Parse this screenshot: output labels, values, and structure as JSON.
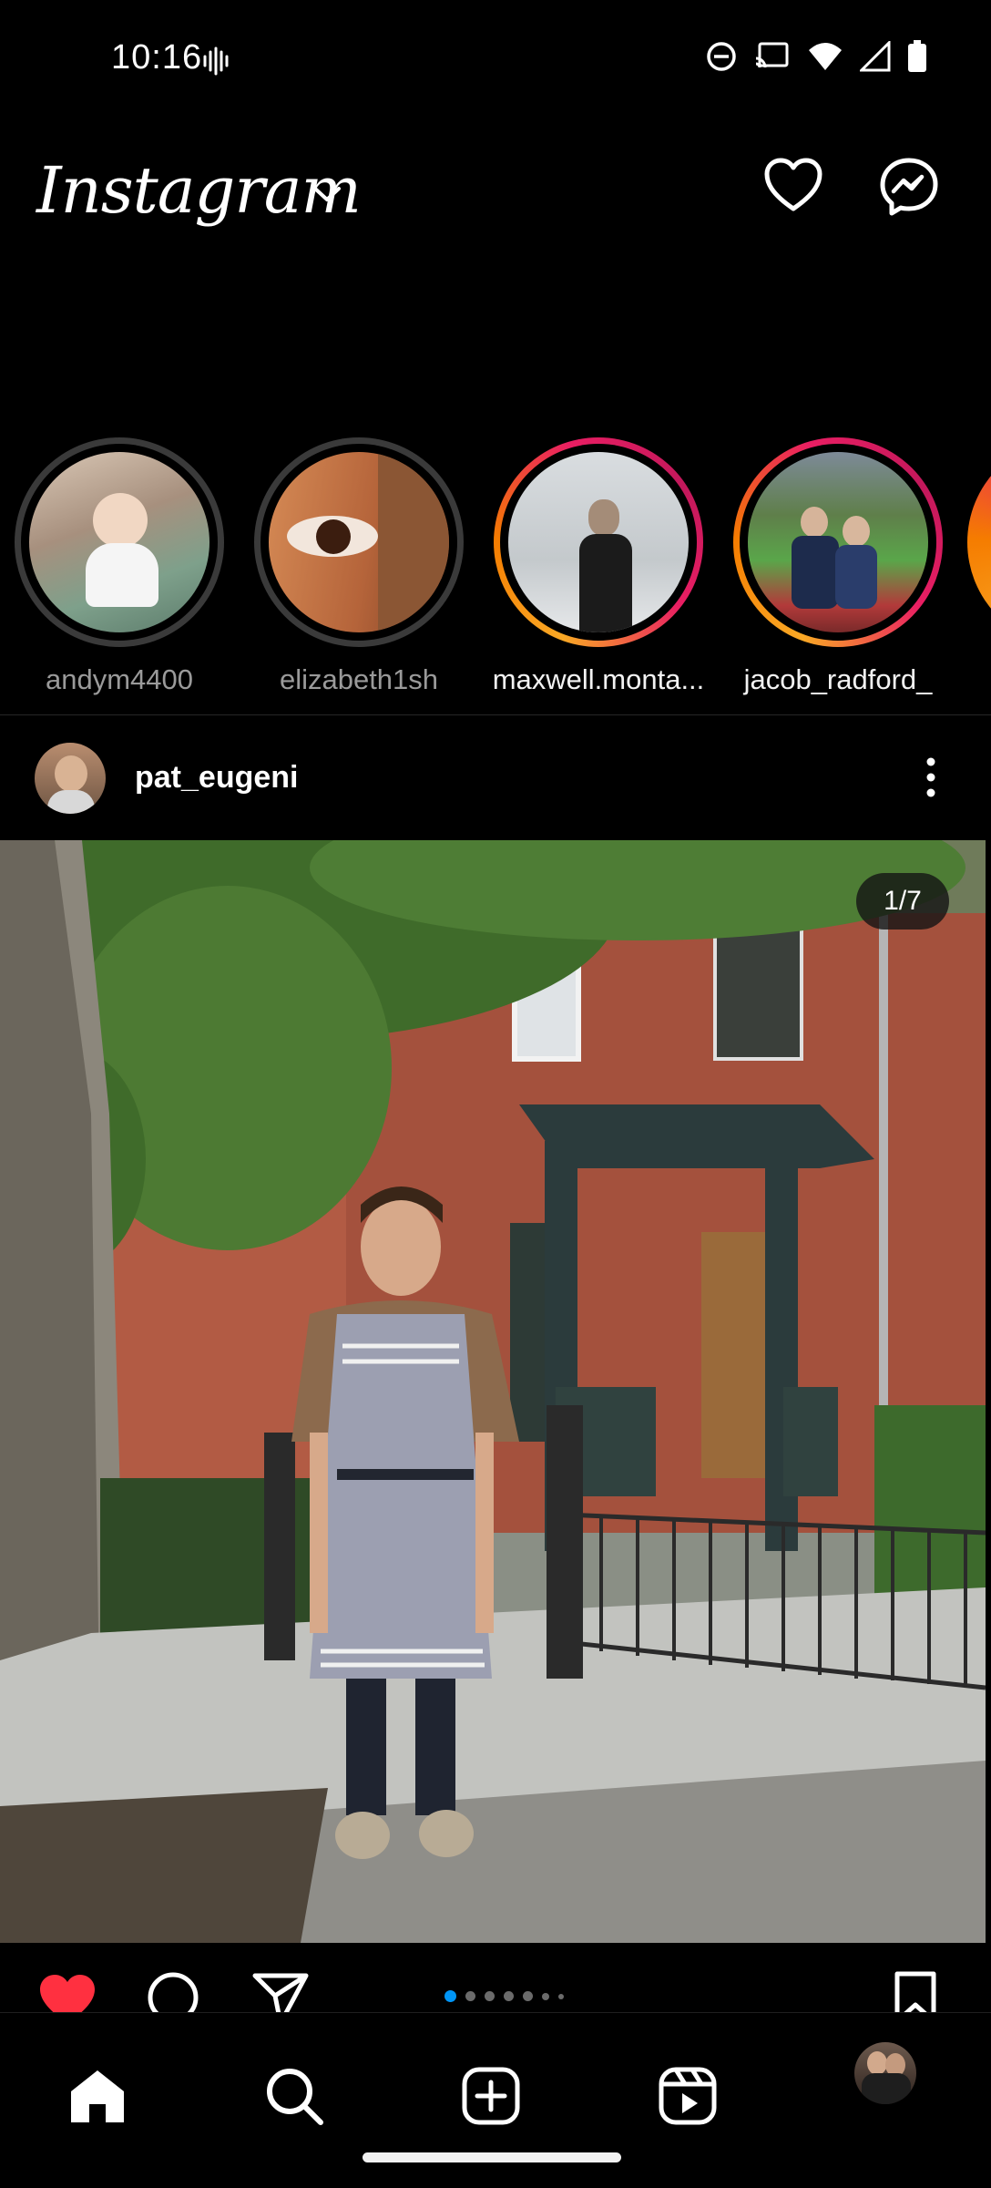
{
  "status_bar": {
    "time": "10:16",
    "icons": [
      "vibrate-icon",
      "do-not-disturb-icon",
      "cast-icon",
      "wifi-icon",
      "signal-icon",
      "battery-icon"
    ]
  },
  "header": {
    "logo_text": "Instagram",
    "icons": [
      "chevron-down-icon",
      "heart-icon",
      "messenger-icon"
    ]
  },
  "stories": [
    {
      "username": "andym4400",
      "state": "seen"
    },
    {
      "username": "elizabeth1sh",
      "state": "seen"
    },
    {
      "username": "maxwell.monta...",
      "state": "new"
    },
    {
      "username": "jacob_radford_",
      "state": "new"
    }
  ],
  "post": {
    "username": "pat_eugeni",
    "image_counter": "1/7",
    "liked": true,
    "carousel_total": 7,
    "carousel_active": 1
  },
  "colors": {
    "background": "#000000",
    "like_red": "#ff3040",
    "carousel_active": "#0095f6",
    "story_ring_gradient": [
      "#f9a825",
      "#e91e63",
      "#c2185b"
    ]
  },
  "bottom_nav": {
    "items": [
      "home-icon",
      "search-icon",
      "create-post-icon",
      "reels-icon",
      "profile-avatar"
    ],
    "active": "home-icon"
  }
}
